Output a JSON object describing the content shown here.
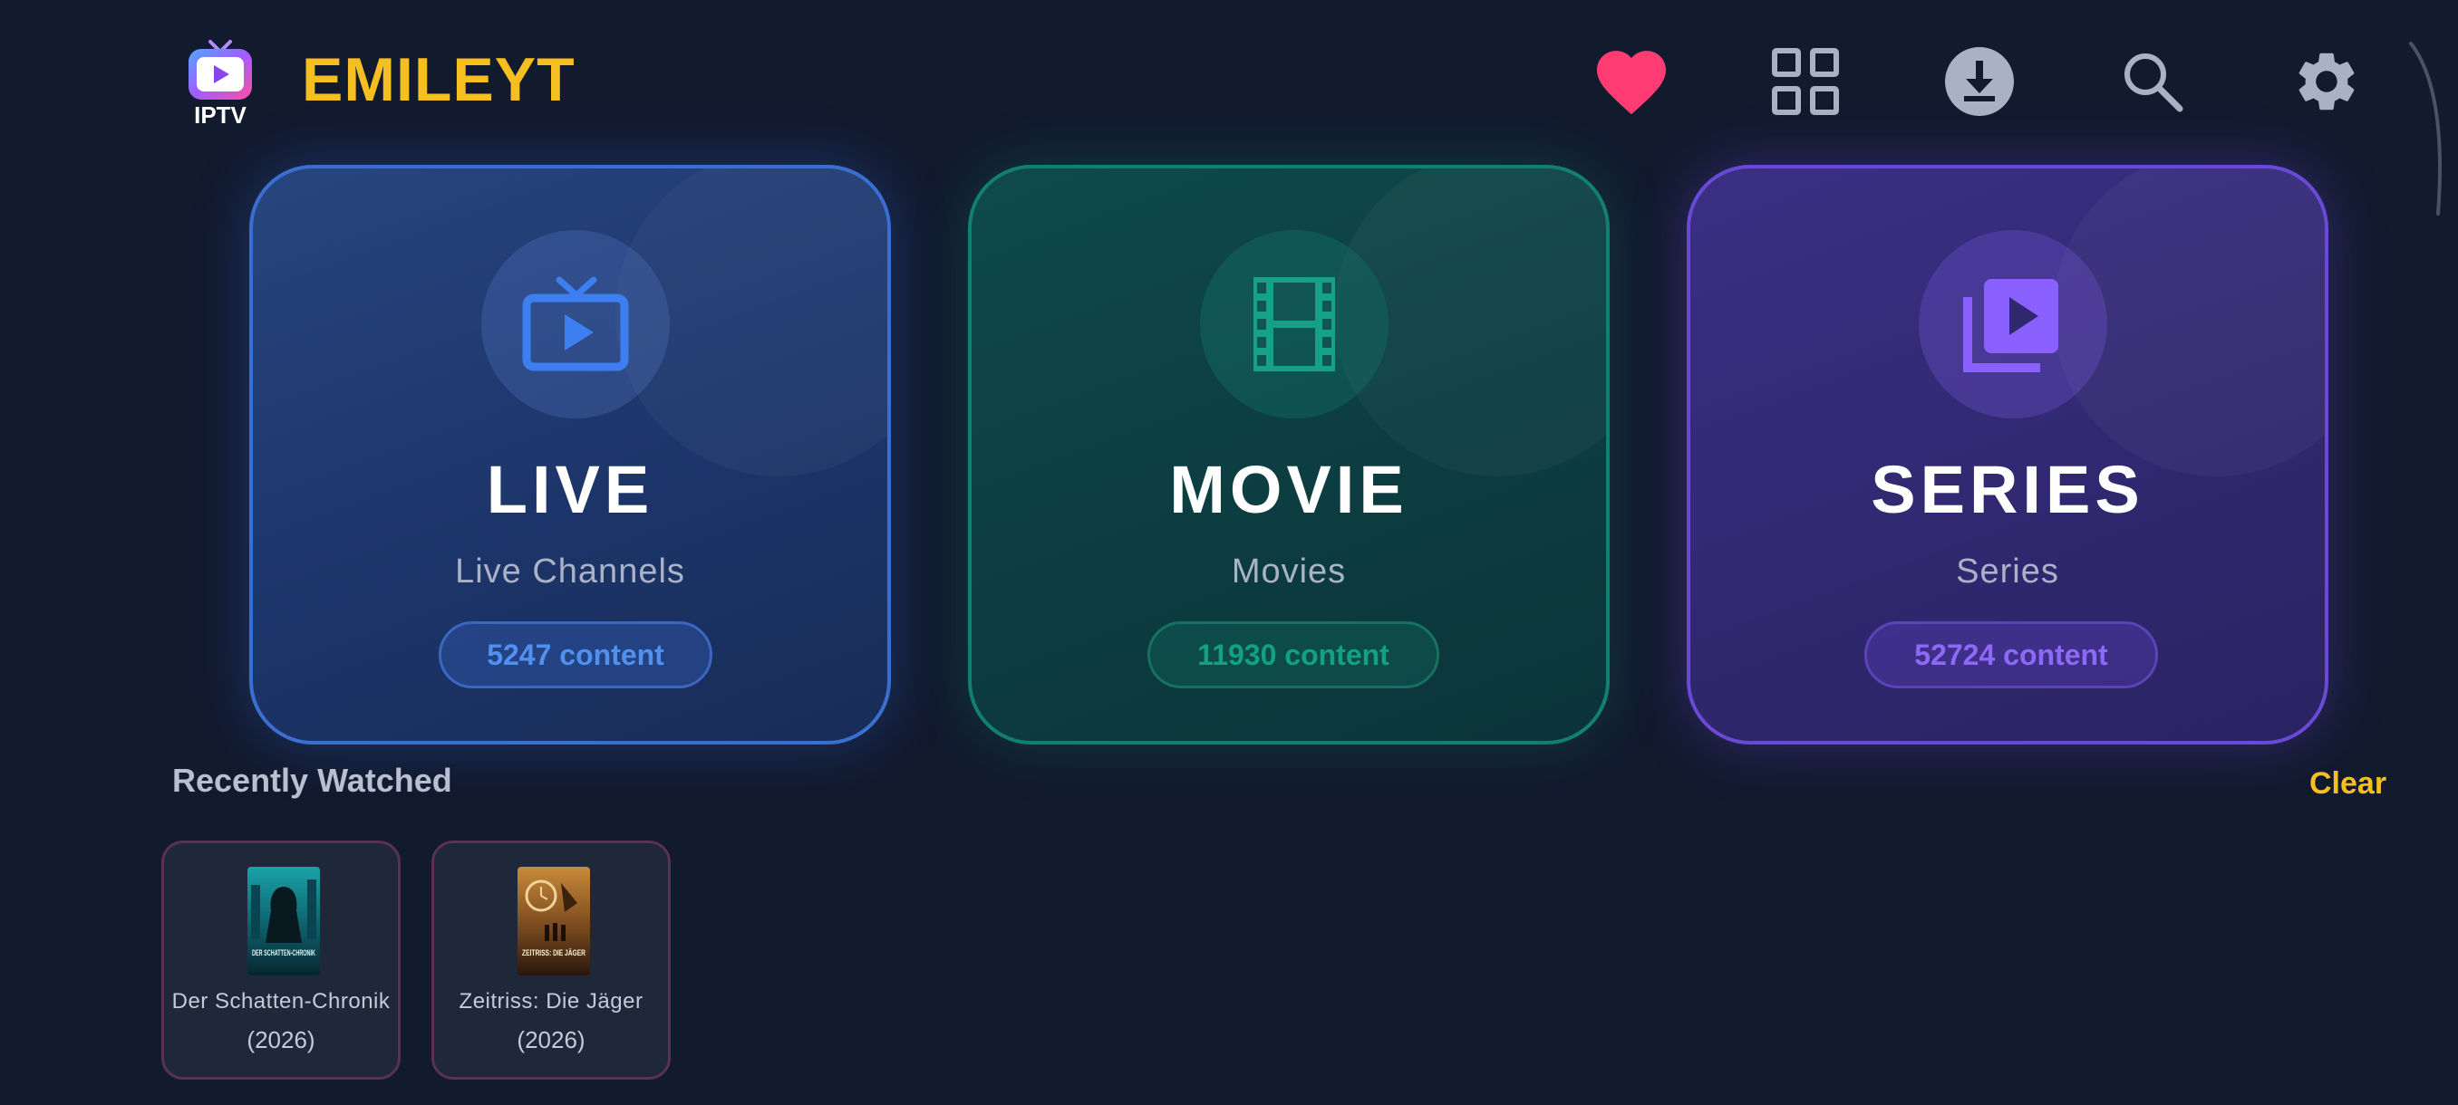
{
  "header": {
    "logo_text": "IPTV",
    "title": "EMILEYT",
    "icons": [
      "heart-icon",
      "grid-icon",
      "download-icon",
      "search-icon",
      "gear-icon"
    ]
  },
  "categories": [
    {
      "title": "LIVE",
      "subtitle": "Live Channels",
      "count": "5247 content",
      "icon": "tv-icon",
      "accent": "#3a6fd0"
    },
    {
      "title": "MOVIE",
      "subtitle": "Movies",
      "count": "11930 content",
      "icon": "film-icon",
      "accent": "#12806f"
    },
    {
      "title": "SERIES",
      "subtitle": "Series",
      "count": "52724 content",
      "icon": "video-library-icon",
      "accent": "#6a49d6"
    }
  ],
  "recently_watched": {
    "title": "Recently Watched",
    "clear_label": "Clear",
    "items": [
      {
        "title": "Der Schatten-Chronik",
        "year": "(2026)",
        "poster_text": "DER SCHATTEN-CHRONIK"
      },
      {
        "title": "Zeitriss: Die Jäger",
        "year": "(2026)",
        "poster_text": "ZEITRISS: DIE JÄGER"
      }
    ]
  },
  "colors": {
    "background": "#121a2e",
    "brand": "#f5bf22",
    "favorite": "#ff3b74"
  }
}
